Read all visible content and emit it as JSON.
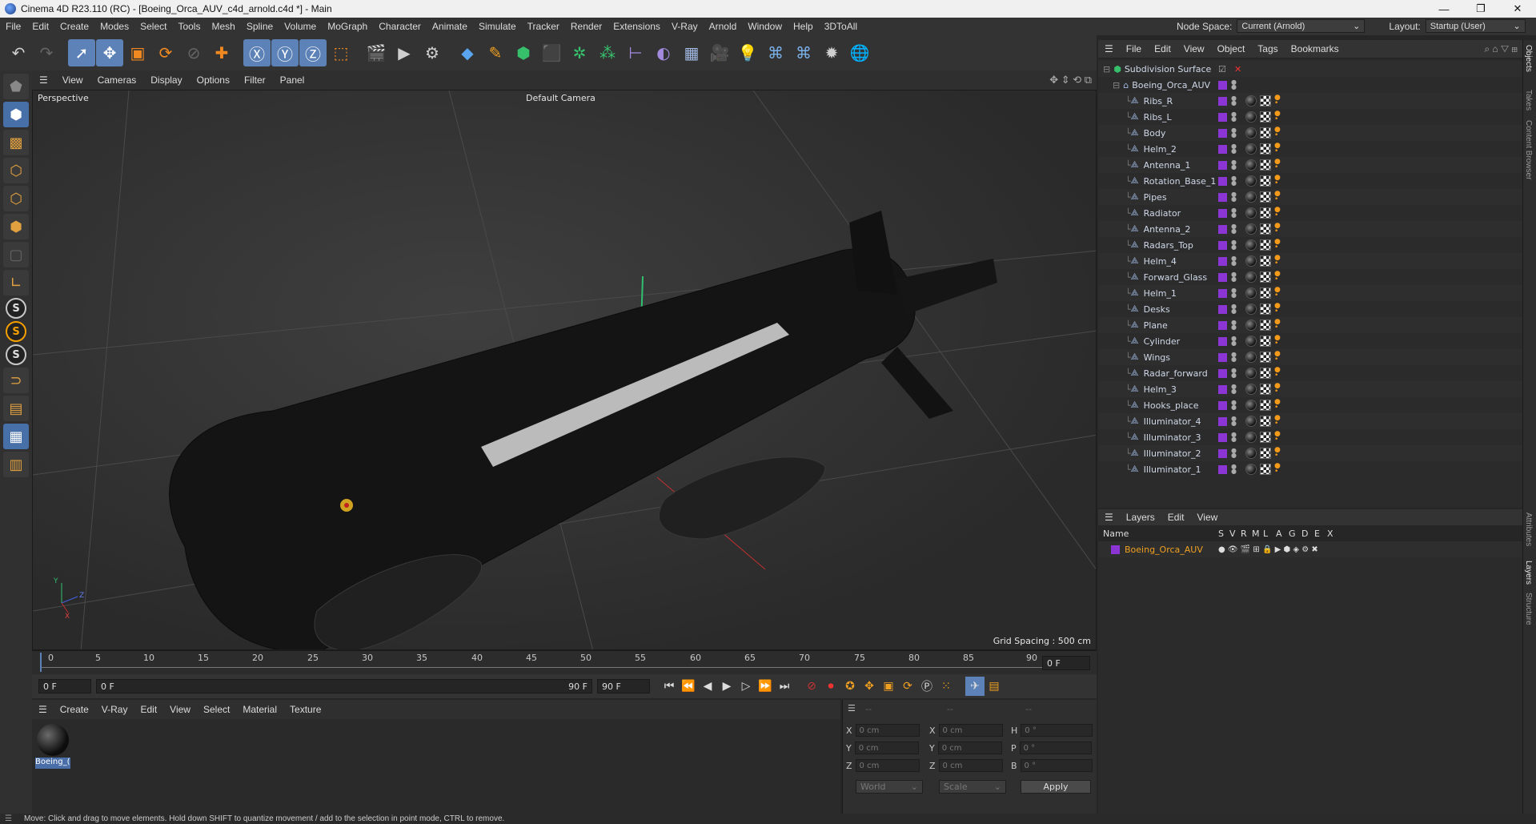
{
  "window": {
    "title": "Cinema 4D R23.110 (RC) - [Boeing_Orca_AUV_c4d_arnold.c4d *] - Main"
  },
  "menu": [
    "File",
    "Edit",
    "Create",
    "Modes",
    "Select",
    "Tools",
    "Mesh",
    "Spline",
    "Volume",
    "MoGraph",
    "Character",
    "Animate",
    "Simulate",
    "Tracker",
    "Render",
    "Extensions",
    "V-Ray",
    "Arnold",
    "Window",
    "Help",
    "3DToAll"
  ],
  "nodespace": {
    "label": "Node Space:",
    "value": "Current (Arnold)"
  },
  "layout": {
    "label": "Layout:",
    "value": "Startup (User)"
  },
  "viewport": {
    "menu": [
      "View",
      "Cameras",
      "Display",
      "Options",
      "Filter",
      "Panel"
    ],
    "projection": "Perspective",
    "camera": "Default Camera",
    "grid_spacing": "Grid Spacing : 500 cm",
    "axis_labels": {
      "y": "Y",
      "z": "Z",
      "x": "X"
    }
  },
  "timeline": {
    "ticks": [
      "0",
      "5",
      "10",
      "15",
      "20",
      "25",
      "30",
      "35",
      "40",
      "45",
      "50",
      "55",
      "60",
      "65",
      "70",
      "75",
      "80",
      "85",
      "90"
    ],
    "current_frame_right": "0 F",
    "start_field": "0 F",
    "range_start": "0 F",
    "range_end": "90 F",
    "end_field": "90 F"
  },
  "material_manager": {
    "menu": [
      "Create",
      "V-Ray",
      "Edit",
      "View",
      "Select",
      "Material",
      "Texture"
    ],
    "materials": [
      {
        "name": "Boeing_("
      }
    ]
  },
  "coordinates": {
    "headers": [
      "--",
      "--",
      "--"
    ],
    "rows": [
      {
        "a": "X",
        "av": "0 cm",
        "b": "X",
        "bv": "0 cm",
        "c": "H",
        "cv": "0 °"
      },
      {
        "a": "Y",
        "av": "0 cm",
        "b": "Y",
        "bv": "0 cm",
        "c": "P",
        "cv": "0 °"
      },
      {
        "a": "Z",
        "av": "0 cm",
        "b": "Z",
        "bv": "0 cm",
        "c": "B",
        "cv": "0 °"
      }
    ],
    "mode1": "World",
    "mode2": "Scale",
    "apply": "Apply"
  },
  "object_manager": {
    "menu": [
      "File",
      "Edit",
      "View",
      "Object",
      "Tags",
      "Bookmarks"
    ],
    "root": "Subdivision Surface",
    "group": "Boeing_Orca_AUV",
    "objects": [
      "Ribs_R",
      "Ribs_L",
      "Body",
      "Helm_2",
      "Antenna_1",
      "Rotation_Base_1",
      "Pipes",
      "Radiator",
      "Antenna_2",
      "Radars_Top",
      "Helm_4",
      "Forward_Glass",
      "Helm_1",
      "Desks",
      "Plane",
      "Cylinder",
      "Wings",
      "Radar_forward",
      "Helm_3",
      "Hooks_place",
      "Illuminator_4",
      "Illuminator_3",
      "Illuminator_2",
      "Illuminator_1"
    ]
  },
  "layers": {
    "menu": [
      "Layers",
      "Edit",
      "View"
    ],
    "columns": [
      "Name",
      "S",
      "V",
      "R",
      "M",
      "L",
      "A",
      "G",
      "D",
      "E",
      "X"
    ],
    "items": [
      {
        "name": "Boeing_Orca_AUV"
      }
    ]
  },
  "right_tabs": [
    "Objects",
    "Takes",
    "Content Browser",
    "Attributes",
    "Layers",
    "Structure"
  ],
  "status": "Move: Click and drag to move elements. Hold down SHIFT to quantize movement / add to the selection in point mode, CTRL to remove.",
  "colors": {
    "accent": "#5c82b8",
    "layer_purple": "#8a35d4",
    "tag_orange": "#f39a1a",
    "layer_name": "#f0a020"
  }
}
